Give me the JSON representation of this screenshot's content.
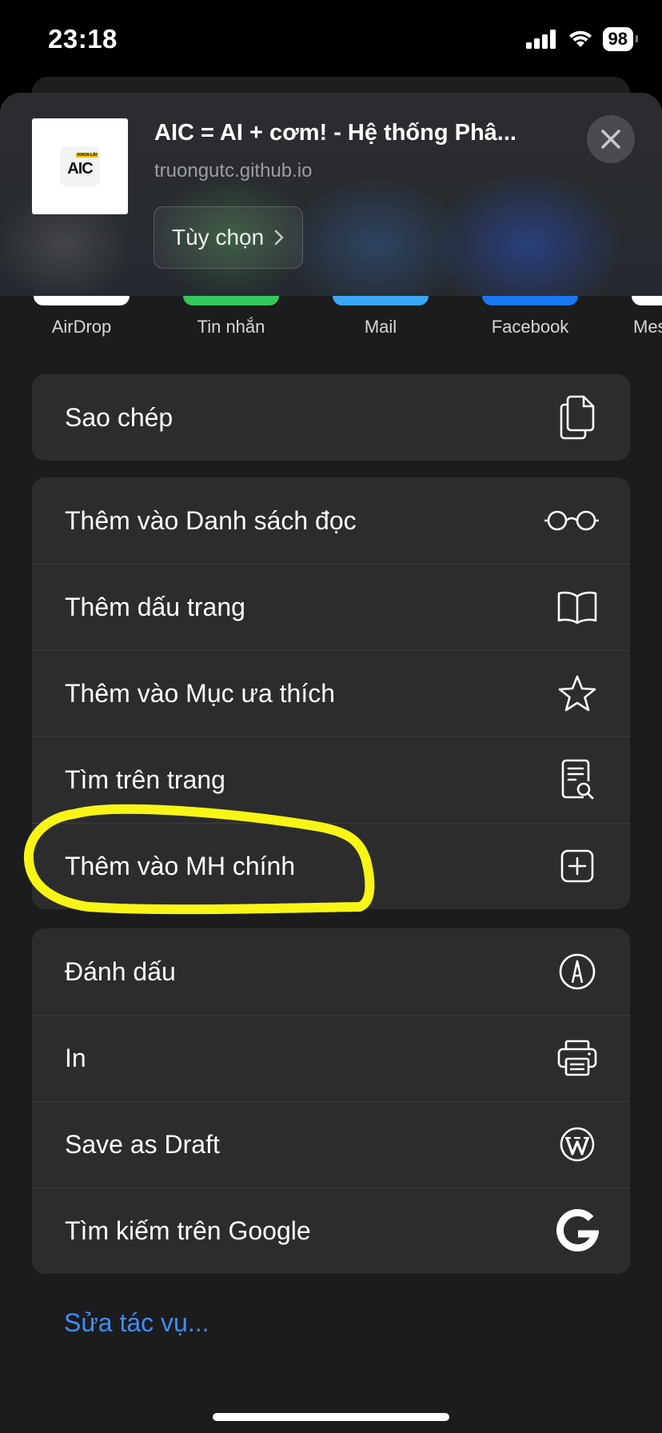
{
  "status_bar": {
    "time": "23:18",
    "battery": "98"
  },
  "share_header": {
    "title": "AIC = AI + cơm! - Hệ thống Phâ...",
    "domain": "truongutc.github.io",
    "options_label": "Tùy chọn",
    "thumbnail_text": "AIC",
    "thumbnail_badge": "KHOA LÁI"
  },
  "apps": [
    {
      "label": "AirDrop",
      "color": "#ffffff"
    },
    {
      "label": "Tin nhắn",
      "color": "#34c759"
    },
    {
      "label": "Mail",
      "color": "#3aa7f5"
    },
    {
      "label": "Facebook",
      "color": "#1877f2"
    },
    {
      "label": "Mes",
      "color": "#ffffff"
    }
  ],
  "actions": {
    "copy": "Sao chép",
    "add_reading_list": "Thêm vào Danh sách đọc",
    "add_bookmark": "Thêm dấu trang",
    "add_favorites": "Thêm vào Mục ưa thích",
    "find_on_page": "Tìm trên trang",
    "add_home_screen": "Thêm vào MH chính",
    "markup": "Đánh dấu",
    "print": "In",
    "save_draft": "Save as Draft",
    "google_search": "Tìm kiếm trên Google"
  },
  "edit_actions": "Sửa tác vụ...",
  "colors": {
    "accent": "#3f8ef7",
    "highlight": "#f8f516",
    "sheet": "#1c1c1e",
    "row": "#2c2c2e"
  },
  "icons": [
    "copy-icon",
    "glasses-icon",
    "book-icon",
    "star-icon",
    "find-doc-icon",
    "add-square-icon",
    "markup-icon",
    "printer-icon",
    "wordpress-icon",
    "google-icon",
    "close-icon",
    "chevron-right-icon"
  ]
}
